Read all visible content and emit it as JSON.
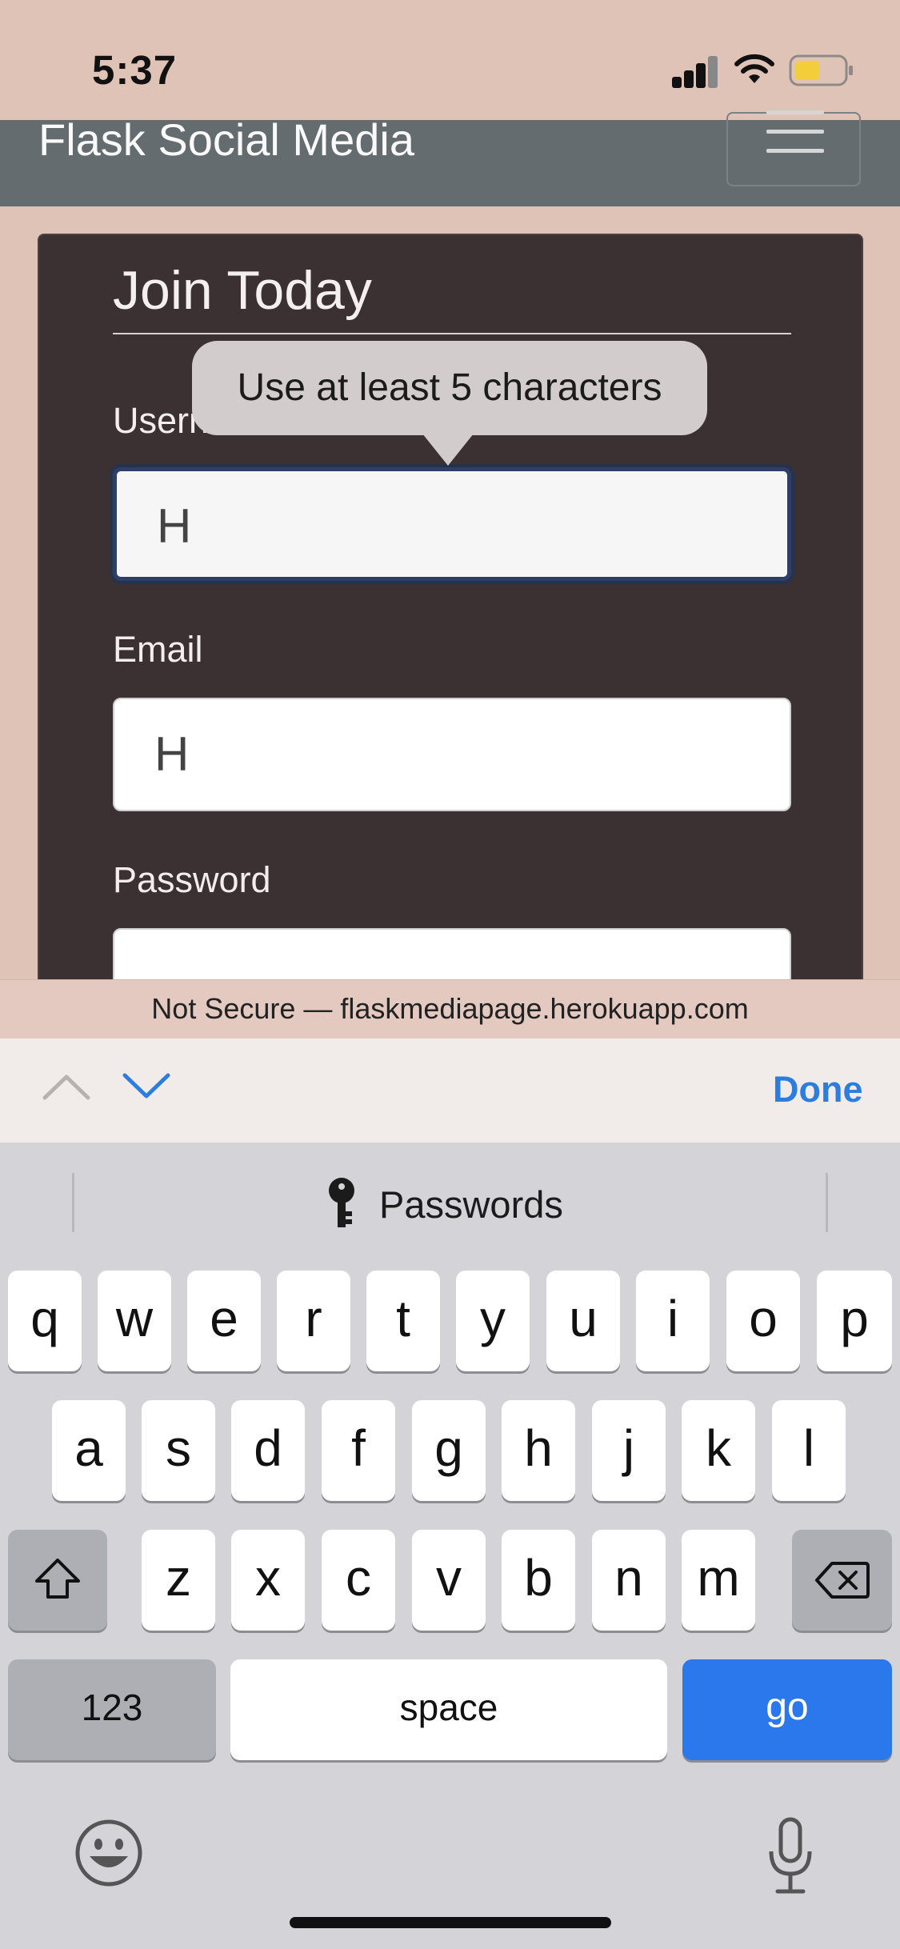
{
  "status_bar": {
    "time": "5:37"
  },
  "navbar": {
    "brand": "Flask Social Media"
  },
  "form": {
    "legend": "Join Today",
    "username_label": "Username",
    "username_value": "H",
    "email_label": "Email",
    "email_value": "H",
    "password_label": "Password",
    "tooltip": "Use at least 5 characters"
  },
  "url_bar": {
    "text": "Not Secure — flaskmediapage.herokuapp.com"
  },
  "accessory": {
    "done_label": "Done"
  },
  "keyboard": {
    "suggestion": "Passwords",
    "row1": [
      "q",
      "w",
      "e",
      "r",
      "t",
      "y",
      "u",
      "i",
      "o",
      "p"
    ],
    "row2": [
      "a",
      "s",
      "d",
      "f",
      "g",
      "h",
      "j",
      "k",
      "l"
    ],
    "row3": [
      "z",
      "x",
      "c",
      "v",
      "b",
      "n",
      "m"
    ],
    "numbers_label": "123",
    "space_label": "space",
    "go_label": "go"
  },
  "colors": {
    "accent": "#2b78ed",
    "navbar": "#646c70",
    "card": "#3b3132",
    "page_bg": "#e0c3b7"
  }
}
